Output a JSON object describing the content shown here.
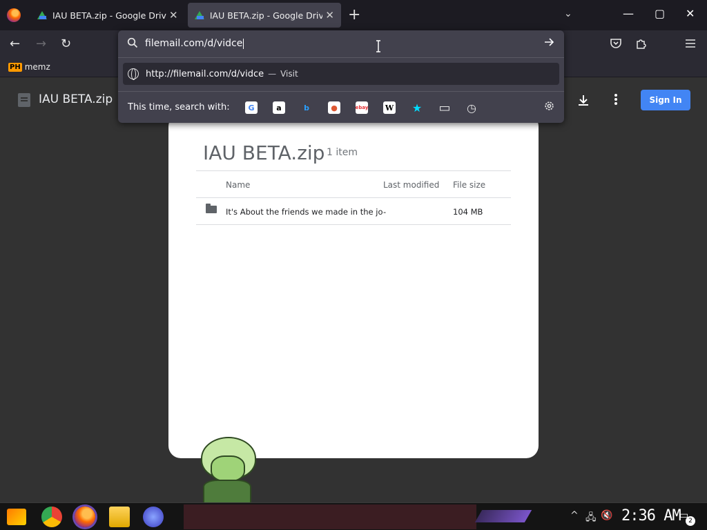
{
  "browser": {
    "tabs": [
      {
        "title": "IAU BETA.zip - Google Drive",
        "close": "✕"
      },
      {
        "title": "IAU BETA.zip - Google Drive",
        "close": "✕"
      }
    ],
    "new_tab_glyph": "+",
    "tab_list_glyph": "⌄",
    "window_controls": {
      "minimize": "—",
      "maximize": "▢",
      "close": "✕"
    }
  },
  "toolbar": {
    "back_glyph": "←",
    "forward_glyph": "→",
    "reload_glyph": "↻"
  },
  "bookmarks": [
    {
      "icon_text": "PH",
      "label": "memz"
    }
  ],
  "urlbar": {
    "value": "filemail.com/d/vidce",
    "suggestion_url": "http://filemail.com/d/vidce",
    "suggestion_separator": "—",
    "suggestion_action": "Visit",
    "search_with_label": "This time, search with:",
    "engines": [
      {
        "name": "google-icon",
        "glyph": "G",
        "color": "#4285f4",
        "bg": "#ffffff"
      },
      {
        "name": "amazon-icon",
        "glyph": "a",
        "color": "#000000",
        "bg": "#ffffff"
      },
      {
        "name": "bing-icon",
        "glyph": "b",
        "color": "#2aa0ff",
        "bg": "transparent"
      },
      {
        "name": "duckduckgo-icon",
        "glyph": "●",
        "color": "#de5833",
        "bg": "#ffffff"
      },
      {
        "name": "ebay-icon",
        "glyph": "ebay",
        "color": "#e53238",
        "bg": "#ffffff"
      },
      {
        "name": "wikipedia-icon",
        "glyph": "W",
        "color": "#000000",
        "bg": "#ffffff"
      },
      {
        "name": "bookmarks-star-icon",
        "glyph": "★",
        "color": "#00ddff",
        "bg": "transparent"
      },
      {
        "name": "tabs-icon",
        "glyph": "▭",
        "color": "#e6e6e6",
        "bg": "transparent"
      },
      {
        "name": "history-icon",
        "glyph": "◷",
        "color": "#e6e6e6",
        "bg": "transparent"
      }
    ]
  },
  "drive": {
    "file_title": "IAU BETA.zip",
    "sign_in": "Sign In",
    "card": {
      "title": "IAU BETA.zip",
      "count": "1 item",
      "columns": [
        "Name",
        "Last modified",
        "File size"
      ],
      "rows": [
        {
          "name": "It's About the friends we made in the jou...",
          "modified": "-",
          "size": "104 MB"
        }
      ]
    }
  },
  "taskbar": {
    "clock": "2:36 AM",
    "notification_count": "2"
  },
  "colors": {
    "accent_blue": "#4285f4",
    "tab_active": "#42414d",
    "toolbar": "#2b2a33"
  }
}
